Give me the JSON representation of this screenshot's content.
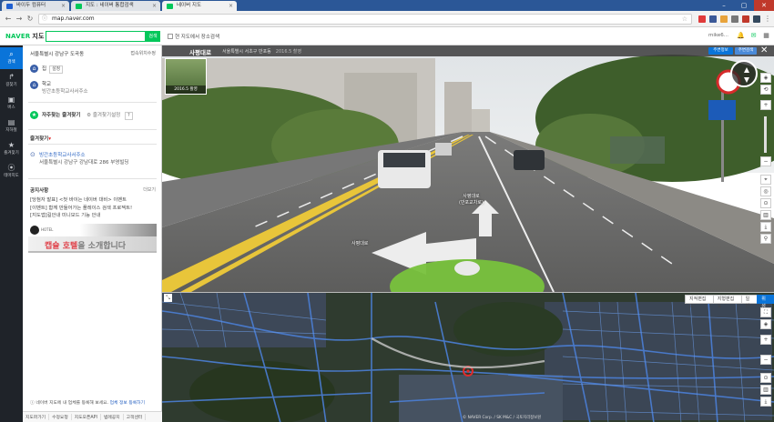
{
  "browser": {
    "tabs": [
      {
        "title": "바이두 컴퓨터",
        "favicon_color": "#1e5fd1"
      },
      {
        "title": "지도 : 네이버 통합검색",
        "favicon_color": "#03c75a"
      },
      {
        "title": "네이버 지도",
        "favicon_color": "#03c75a"
      }
    ],
    "url": "map.naver.com"
  },
  "header": {
    "logo": "NAVER",
    "logo_suffix": "지도",
    "search_placeholder": "",
    "search_button": "검색",
    "checkbox_label": "현 지도에서 장소검색",
    "user_name": "mike6..."
  },
  "left_nav": [
    {
      "label": "검색",
      "icon": "search-icon"
    },
    {
      "label": "길찾기",
      "icon": "directions-icon"
    },
    {
      "label": "버스",
      "icon": "bus-icon"
    },
    {
      "label": "지하철",
      "icon": "subway-icon"
    },
    {
      "label": "즐겨찾기",
      "icon": "star-icon"
    },
    {
      "label": "테마지도",
      "icon": "theme-map-icon"
    }
  ],
  "panel": {
    "location": "서울특별시 강남구 도곡동",
    "location_link": "접속위치수정",
    "home_label": "집",
    "home_button": "설정",
    "school_label": "학교",
    "school_address": "빙간초등학교사서주소",
    "favorites_cta": "자주찾는 즐겨찾기",
    "favorites_setting": "즐겨찾기설정",
    "favorites_header": "즐겨찾기",
    "fav_item_title": "빙간초등학교사서주소",
    "fav_item_address": "서울특별시 강남구 강남대로 286 부영빌딩",
    "notice_title": "공지사항",
    "notice_more": "더보기",
    "notices": [
      "[당첨자 발표] <첫 바이는 네이버 대비> 이벤트",
      "[이벤트] 함께 만들어가는 플레이스 검색 프로젝트!",
      "[지도앱]길안내 미니모드 기능 안내"
    ],
    "ad_brand": "HOTEL",
    "ad_text_a": "캡슐 호텔",
    "ad_text_b": "을 소개합니다",
    "footer_note": "네이버 지도에 내 업체를 등록해 보세요.",
    "footer_note_link": "업체 정보 등록하기",
    "bottombar": [
      "지도퍼가기",
      "수정요청",
      "지도오픈API",
      "범례공지",
      "고객센터"
    ]
  },
  "streetview": {
    "title": "사평대로",
    "address": "서울특별시 서초구 반포동",
    "date": "2016.5 촬영",
    "thumb_label": "2016.5 촬영",
    "btn_1": "주변정보",
    "btn_2": "주변검색",
    "road_label_1": "사평대로",
    "road_label_1b": "(반포교차로)",
    "road_label_2": "사평대로"
  },
  "map": {
    "types": [
      {
        "label": "지적편집도",
        "selected": false
      },
      {
        "label": "지형편집도",
        "selected": false
      },
      {
        "label": "일반",
        "selected": false
      },
      {
        "label": "위성",
        "selected": true
      }
    ],
    "copyright": "© NAVER Corp. / SK M&C / 국토지리정보원"
  },
  "colors": {
    "naver_green": "#03c75a",
    "accent_blue": "#0a74d9",
    "nav_dark": "#1f2329"
  }
}
